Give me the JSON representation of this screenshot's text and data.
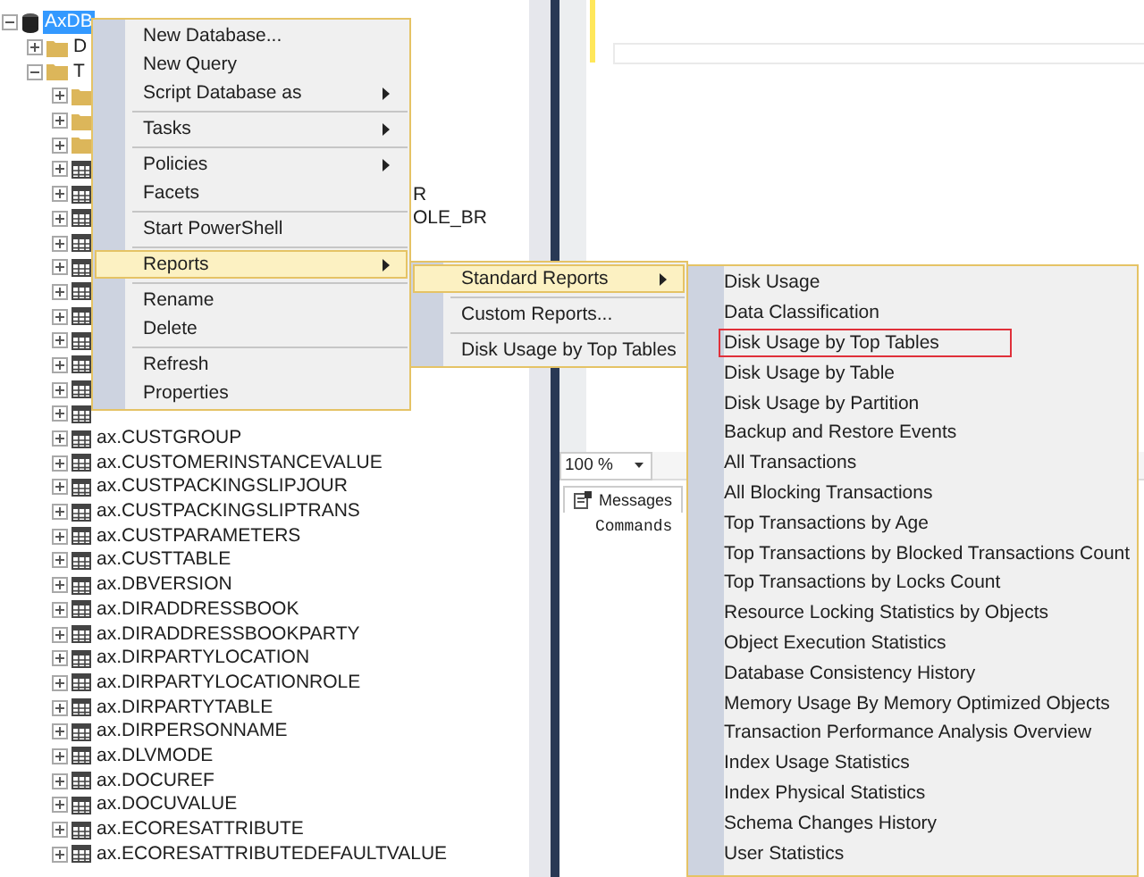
{
  "tree": {
    "root": {
      "label": "AxDB",
      "kind": "database",
      "selected": true,
      "expanded": true,
      "children": [
        {
          "label": "D",
          "kind": "folder",
          "expanded": false
        },
        {
          "label": "T",
          "kind": "folder",
          "expanded": true,
          "children": [
            {
              "kind": "folder",
              "expanded": false
            },
            {
              "kind": "folder",
              "expanded": false
            },
            {
              "kind": "folder",
              "expanded": false
            },
            {
              "kind": "table",
              "expanded": false
            },
            {
              "kind": "table",
              "expanded": false,
              "tail": "R"
            },
            {
              "kind": "table",
              "expanded": false,
              "tail": "OLE_BR"
            },
            {
              "kind": "table",
              "expanded": false
            },
            {
              "kind": "table",
              "expanded": false
            },
            {
              "kind": "table",
              "expanded": false
            },
            {
              "kind": "table",
              "expanded": false
            },
            {
              "kind": "table",
              "expanded": false
            },
            {
              "kind": "table",
              "expanded": false
            },
            {
              "kind": "table",
              "expanded": false
            },
            {
              "kind": "table",
              "expanded": false
            },
            {
              "label": "ax.CUSTGROUP",
              "kind": "table",
              "expanded": false
            },
            {
              "label": "ax.CUSTOMERINSTANCEVALUE",
              "kind": "table",
              "expanded": false
            },
            {
              "label": "ax.CUSTPACKINGSLIPJOUR",
              "kind": "table",
              "expanded": false
            },
            {
              "label": "ax.CUSTPACKINGSLIPTRANS",
              "kind": "table",
              "expanded": false
            },
            {
              "label": "ax.CUSTPARAMETERS",
              "kind": "table",
              "expanded": false
            },
            {
              "label": "ax.CUSTTABLE",
              "kind": "table",
              "expanded": false
            },
            {
              "label": "ax.DBVERSION",
              "kind": "table",
              "expanded": false
            },
            {
              "label": "ax.DIRADDRESSBOOK",
              "kind": "table",
              "expanded": false
            },
            {
              "label": "ax.DIRADDRESSBOOKPARTY",
              "kind": "table",
              "expanded": false
            },
            {
              "label": "ax.DIRPARTYLOCATION",
              "kind": "table",
              "expanded": false
            },
            {
              "label": "ax.DIRPARTYLOCATIONROLE",
              "kind": "table",
              "expanded": false
            },
            {
              "label": "ax.DIRPARTYTABLE",
              "kind": "table",
              "expanded": false
            },
            {
              "label": "ax.DIRPERSONNAME",
              "kind": "table",
              "expanded": false
            },
            {
              "label": "ax.DLVMODE",
              "kind": "table",
              "expanded": false
            },
            {
              "label": "ax.DOCUREF",
              "kind": "table",
              "expanded": false
            },
            {
              "label": "ax.DOCUVALUE",
              "kind": "table",
              "expanded": false
            },
            {
              "label": "ax.ECORESATTRIBUTE",
              "kind": "table",
              "expanded": false
            },
            {
              "label": "ax.ECORESATTRIBUTEDEFAULTVALUE",
              "kind": "table",
              "expanded": false
            }
          ]
        }
      ]
    }
  },
  "editor": {
    "zoom": "100 %",
    "tabs": [
      {
        "label": "Messages",
        "selected": true
      }
    ],
    "message": "Commands"
  },
  "context_menu": {
    "items": [
      {
        "kind": "item",
        "label": "New Database...",
        "submenu": false,
        "selected": false
      },
      {
        "kind": "item",
        "label": "New Query",
        "submenu": false,
        "selected": false
      },
      {
        "kind": "item",
        "label": "Script Database as",
        "submenu": true,
        "selected": false
      },
      {
        "kind": "separator"
      },
      {
        "kind": "item",
        "label": "Tasks",
        "submenu": true,
        "selected": false
      },
      {
        "kind": "separator"
      },
      {
        "kind": "item",
        "label": "Policies",
        "submenu": true,
        "selected": false
      },
      {
        "kind": "item",
        "label": "Facets",
        "submenu": false,
        "selected": false
      },
      {
        "kind": "separator"
      },
      {
        "kind": "item",
        "label": "Start PowerShell",
        "submenu": false,
        "selected": false
      },
      {
        "kind": "separator"
      },
      {
        "kind": "item",
        "label": "Reports",
        "submenu": true,
        "selected": true
      },
      {
        "kind": "separator"
      },
      {
        "kind": "item",
        "label": "Rename",
        "submenu": false,
        "selected": false
      },
      {
        "kind": "item",
        "label": "Delete",
        "submenu": false,
        "selected": false
      },
      {
        "kind": "separator"
      },
      {
        "kind": "item",
        "label": "Refresh",
        "submenu": false,
        "selected": false
      },
      {
        "kind": "item",
        "label": "Properties",
        "submenu": false,
        "selected": false
      }
    ]
  },
  "reports_menu": {
    "items": [
      {
        "kind": "item",
        "label": "Standard Reports",
        "submenu": true,
        "selected": true
      },
      {
        "kind": "separator"
      },
      {
        "kind": "item",
        "label": "Custom Reports...",
        "submenu": false,
        "selected": false
      },
      {
        "kind": "separator"
      },
      {
        "kind": "item",
        "label": "Disk Usage by Top Tables",
        "submenu": false,
        "selected": false
      }
    ]
  },
  "standard_reports_menu": {
    "items": [
      {
        "label": "Disk Usage",
        "outlined": false
      },
      {
        "label": "Data Classification",
        "outlined": false
      },
      {
        "label": "Disk Usage by Top Tables",
        "outlined": true
      },
      {
        "label": "Disk Usage by Table",
        "outlined": false
      },
      {
        "label": "Disk Usage by Partition",
        "outlined": false
      },
      {
        "label": "Backup and Restore Events",
        "outlined": false
      },
      {
        "label": "All Transactions",
        "outlined": false
      },
      {
        "label": "All Blocking Transactions",
        "outlined": false
      },
      {
        "label": "Top Transactions by Age",
        "outlined": false
      },
      {
        "label": "Top Transactions by Blocked Transactions Count",
        "outlined": false
      },
      {
        "label": "Top Transactions by Locks Count",
        "outlined": false
      },
      {
        "label": "Resource Locking Statistics by Objects",
        "outlined": false
      },
      {
        "label": "Object Execution Statistics",
        "outlined": false
      },
      {
        "label": "Database Consistency History",
        "outlined": false
      },
      {
        "label": "Memory Usage By Memory Optimized Objects",
        "outlined": false
      },
      {
        "label": "Transaction Performance Analysis Overview",
        "outlined": false
      },
      {
        "label": "Index Usage Statistics",
        "outlined": false
      },
      {
        "label": "Index Physical Statistics",
        "outlined": false
      },
      {
        "label": "Schema Changes History",
        "outlined": false
      },
      {
        "label": "User Statistics",
        "outlined": false
      }
    ]
  }
}
